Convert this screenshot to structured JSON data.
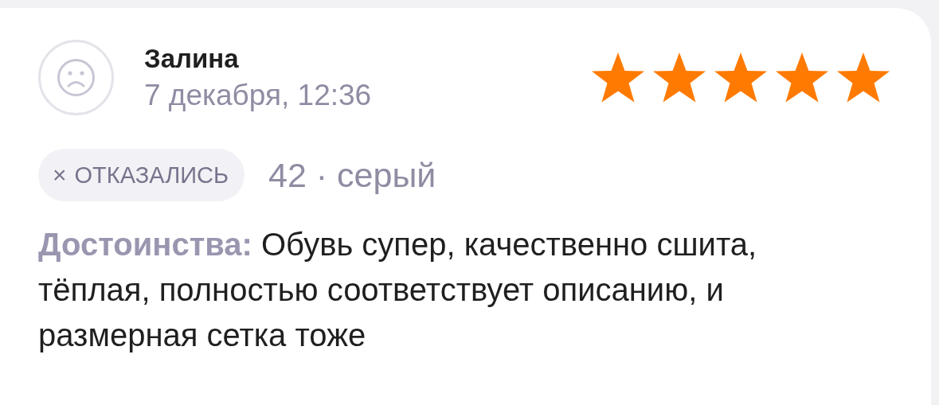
{
  "review": {
    "author": "Залина",
    "date": "7 декабря, 12:36",
    "stars": 5,
    "status": {
      "icon": "×",
      "label": "ОТКАЗАЛИСЬ"
    },
    "variant": "42 · серый",
    "pros": {
      "label": "Достоинства:",
      "text": "Обувь супер, качественно сшита, тёплая, полностью соответствует описанию, и размерная сетка тоже"
    }
  }
}
